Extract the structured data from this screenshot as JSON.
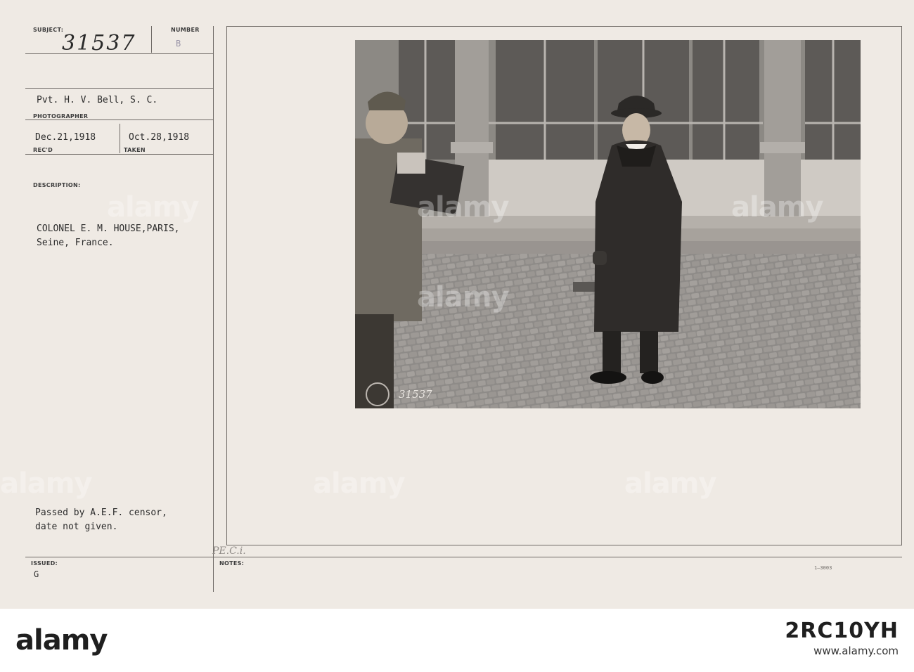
{
  "card": {
    "subject_label": "SUBJECT:",
    "subject_number": "31537",
    "number_label": "NUMBER",
    "number_mark": "B",
    "photographer": "Pvt. H. V. Bell, S. C.",
    "photographer_label": "PHOTOGRAPHER",
    "received_date": "Dec.21,1918",
    "received_label": "REC'D",
    "taken_date": "Oct.28,1918",
    "taken_label": "TAKEN",
    "description_label": "DESCRIPTION:",
    "description": "COLONEL E. M. HOUSE,PARIS,\nSeine, France.",
    "censor_note": "Passed by A.E.F. censor,\ndate not given.",
    "issued_label": "ISSUED:",
    "issued_value": "G",
    "notes_label": "NOTES:",
    "initials": "PE.C.i.",
    "form_code": "1—3003"
  },
  "photo": {
    "negative_number": "31537"
  },
  "watermark": {
    "text": "alamy",
    "footer_logo": "alamy",
    "image_id": "2RC10YH",
    "url": "www.alamy.com"
  }
}
